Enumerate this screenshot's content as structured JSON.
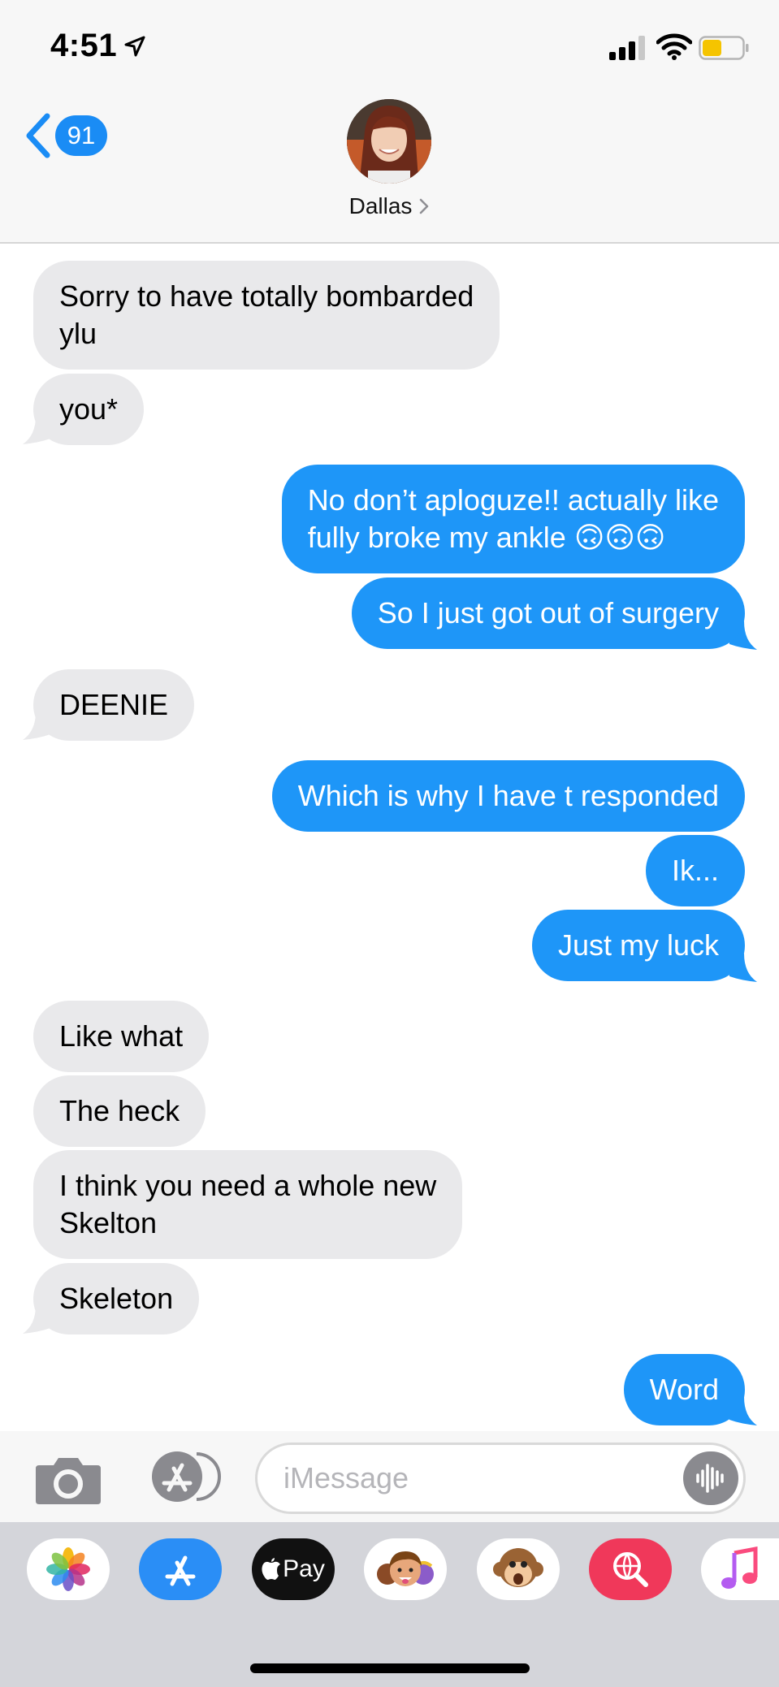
{
  "status_bar": {
    "time": "4:51",
    "icons": [
      "location-arrow-icon",
      "cellular-signal-icon",
      "wifi-icon",
      "battery-icon"
    ],
    "battery_color": "#f5c400"
  },
  "header": {
    "back_badge": "91",
    "contact_name": "Dallas"
  },
  "messages": [
    {
      "direction": "received",
      "lines": [
        "Sorry to have totally bombarded",
        "ylu"
      ]
    },
    {
      "direction": "received",
      "lines": [
        "you*"
      ]
    },
    {
      "direction": "sent",
      "lines": [
        "No don’t aploguze!! actually like",
        "fully broke my ankle 🙃🙃🙃"
      ]
    },
    {
      "direction": "sent",
      "lines": [
        "So I just got out of surgery"
      ]
    },
    {
      "direction": "received",
      "lines": [
        "DEENIE"
      ]
    },
    {
      "direction": "sent",
      "lines": [
        "Which is why I have t responded"
      ]
    },
    {
      "direction": "sent",
      "lines": [
        "Ik..."
      ]
    },
    {
      "direction": "sent",
      "lines": [
        "Just my luck"
      ]
    },
    {
      "direction": "received",
      "lines": [
        "Like what"
      ]
    },
    {
      "direction": "received",
      "lines": [
        "The heck"
      ]
    },
    {
      "direction": "received",
      "lines": [
        "I think you need a whole new",
        "Skelton"
      ]
    },
    {
      "direction": "received",
      "lines": [
        "Skeleton"
      ]
    },
    {
      "direction": "sent",
      "lines": [
        "Word"
      ]
    }
  ],
  "input_bar": {
    "placeholder": "iMessage"
  },
  "app_drawer": {
    "apps": [
      "Photos",
      "App Store",
      "Apple Pay",
      "Memoji",
      "Animoji",
      "Web Images",
      "Music"
    ],
    "apple_pay_label": "Pay"
  },
  "colors": {
    "sent_bubble": "#1e96f8",
    "received_bubble": "#e9e9eb",
    "accent": "#1a8cf5"
  }
}
